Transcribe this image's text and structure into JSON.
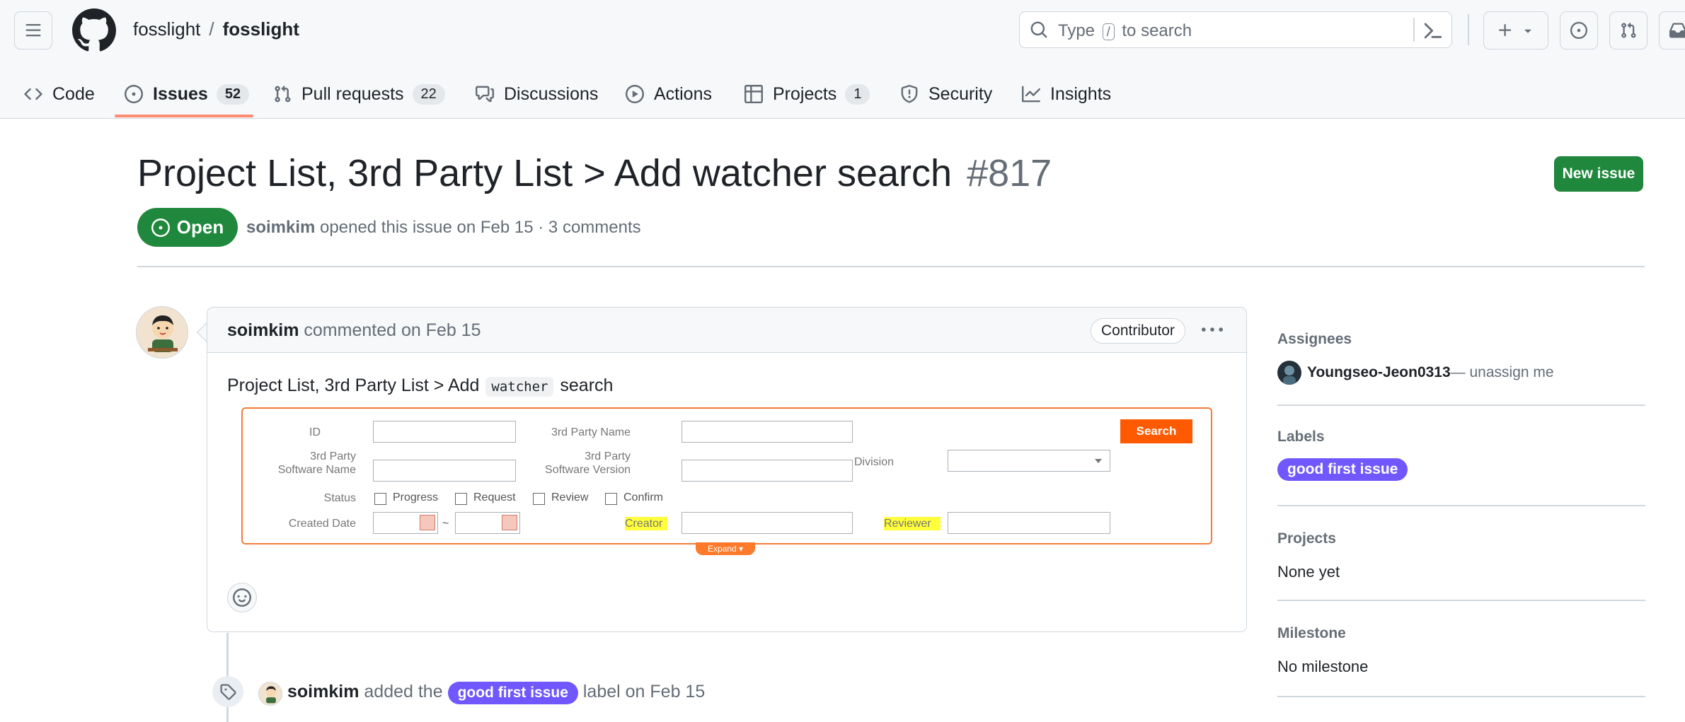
{
  "header": {
    "owner": "fosslight",
    "separator": "/",
    "repo": "fosslight",
    "search_prefix": "Type",
    "search_key": "/",
    "search_suffix": "to search"
  },
  "nav": {
    "tabs": [
      {
        "label": "Code",
        "icon": "code-icon"
      },
      {
        "label": "Issues",
        "count": "52",
        "icon": "issue-opened-icon",
        "selected": true
      },
      {
        "label": "Pull requests",
        "count": "22",
        "icon": "git-pull-request-icon"
      },
      {
        "label": "Discussions",
        "icon": "comment-discussion-icon"
      },
      {
        "label": "Actions",
        "icon": "play-icon"
      },
      {
        "label": "Projects",
        "count": "1",
        "icon": "table-icon"
      },
      {
        "label": "Security",
        "icon": "shield-icon"
      },
      {
        "label": "Insights",
        "icon": "graph-icon"
      }
    ],
    "accent": "#fd8c73"
  },
  "issue": {
    "title": "Project List, 3rd Party List > Add watcher search",
    "number": "#817",
    "new_issue_label": "New issue",
    "state": "Open",
    "state_color": "#1f883d",
    "author": "soimkim",
    "meta_rest": "opened this issue on Feb 15 · 3 comments"
  },
  "comment": {
    "author": "soimkim",
    "action": "commented on Feb 15",
    "role_badge": "Contributor",
    "body_prefix": "Project List, 3rd Party List > Add",
    "body_code": "watcher",
    "body_suffix": "search"
  },
  "form": {
    "id_label": "ID",
    "party_name_label": "3rd Party Name",
    "software_name_line1": "3rd Party",
    "software_name_line2": "Software Name",
    "software_version_line1": "3rd Party",
    "software_version_line2": "Software Version",
    "division_label": "Division",
    "status_label": "Status",
    "status_options": [
      "Progress",
      "Request",
      "Review",
      "Confirm"
    ],
    "created_date_label": "Created Date",
    "date_separator": "~",
    "creator_label": "Creator",
    "reviewer_label": "Reviewer",
    "search_button": "Search",
    "expand_label": "Expand ▾",
    "accent": "#ff5a00"
  },
  "timeline": {
    "author": "soimkim",
    "action_prefix": "added the",
    "label": "good first issue",
    "action_suffix": "label on Feb 15"
  },
  "sidebar": {
    "assignees_heading": "Assignees",
    "assignee_name": "Youngseo-Jeon0313",
    "assignee_action": "— unassign me",
    "labels_heading": "Labels",
    "label_name": "good first issue",
    "label_color": "#7057ff",
    "projects_heading": "Projects",
    "projects_value": "None yet",
    "milestone_heading": "Milestone",
    "milestone_value": "No milestone"
  }
}
